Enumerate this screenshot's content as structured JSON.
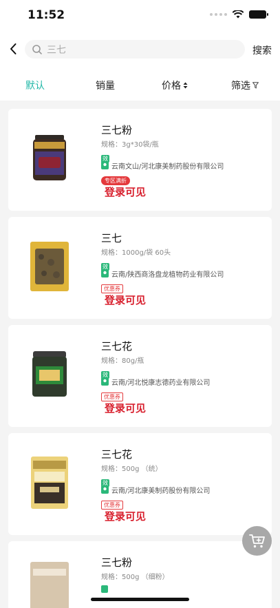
{
  "status": {
    "time": "11:52"
  },
  "search": {
    "value": "三七",
    "button": "搜索"
  },
  "sort": {
    "default": "默认",
    "sales": "销量",
    "price": "价格",
    "filter": "筛选"
  },
  "products": [
    {
      "name": "三七粉",
      "spec": "规格：3g*30袋/瓶",
      "tag": "效",
      "maker": "云南文山/河北康美制药股份有限公司",
      "promo": "专区满折",
      "promo_style": "solid",
      "price_text": "登录可见"
    },
    {
      "name": "三七",
      "spec": "规格：1000g/袋 60头",
      "tag": "效",
      "maker": "云南/陕西商洛盘龙植物药业有限公司",
      "promo": "优惠券",
      "promo_style": "outline",
      "price_text": "登录可见"
    },
    {
      "name": "三七花",
      "spec": "规格：80g/瓶",
      "tag": "效",
      "maker": "云南/河北悦康志德药业有限公司",
      "promo": "优惠券",
      "promo_style": "outline",
      "price_text": "登录可见"
    },
    {
      "name": "三七花",
      "spec": "规格：500g （统）",
      "tag": "效",
      "maker": "云南/河北康美制药股份有限公司",
      "promo": "优惠券",
      "promo_style": "outline",
      "price_text": "登录可见"
    },
    {
      "name": "三七粉",
      "spec": "规格：500g （细粉）",
      "tag": "",
      "maker": "",
      "promo": "",
      "promo_style": "",
      "price_text": ""
    }
  ],
  "icons": {
    "back": "chevron-left-icon",
    "search": "search-icon",
    "filter": "funnel-icon",
    "location": "location-pin-icon",
    "cart": "cart-add-icon"
  },
  "colors": {
    "accent": "#23b8a8",
    "price": "#d8202e",
    "tag": "#2bb87a"
  }
}
